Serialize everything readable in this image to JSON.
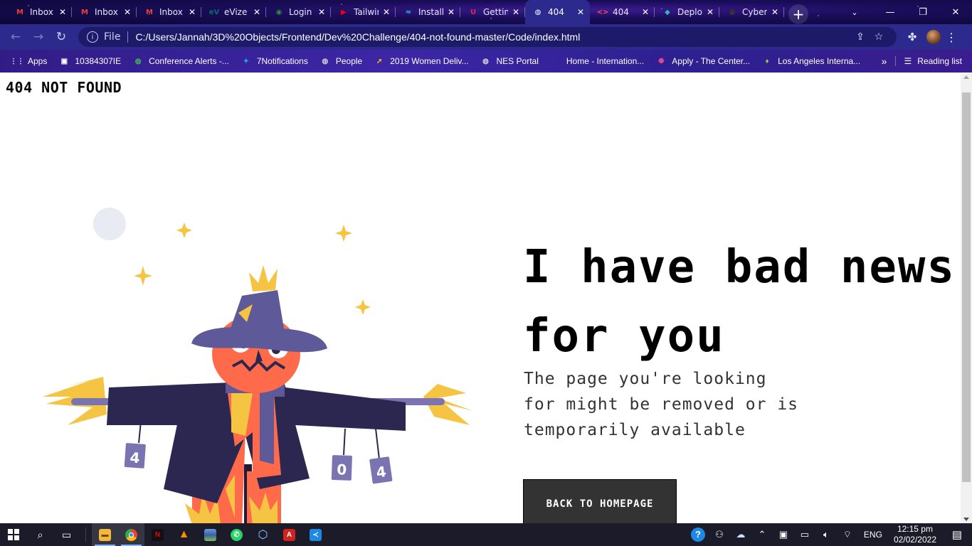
{
  "browser": {
    "tabs": [
      {
        "title": "Inbox",
        "icon": "gmail-icon",
        "fav_text": "M",
        "fav_color": "#ea4335"
      },
      {
        "title": "Inbox",
        "icon": "gmail-icon",
        "fav_text": "M",
        "fav_color": "#ea4335"
      },
      {
        "title": "Inbox",
        "icon": "gmail-icon",
        "fav_text": "M",
        "fav_color": "#ea4335"
      },
      {
        "title": "eVize",
        "icon": "evize-icon",
        "fav_text": "eV",
        "fav_color": "#0d6b6b"
      },
      {
        "title": "Login",
        "icon": "login-icon",
        "fav_text": "◉",
        "fav_color": "#2f8f3a"
      },
      {
        "title": "Tailwind",
        "icon": "youtube-icon",
        "fav_text": "▶",
        "fav_color": "#ff0000"
      },
      {
        "title": "Install",
        "icon": "tailwind-icon",
        "fav_text": "≈",
        "fav_color": "#38bdf8"
      },
      {
        "title": "Getting",
        "icon": "getting-icon",
        "fav_text": "U",
        "fav_color": "#e0245e"
      },
      {
        "title": "404",
        "icon": "globe-icon",
        "fav_text": "◍",
        "fav_color": "#ffffff",
        "active": true
      },
      {
        "title": "404",
        "icon": "code-icon",
        "fav_text": "<>",
        "fav_color": "#ff4b5c"
      },
      {
        "title": "Deploy",
        "icon": "netlify-icon",
        "fav_text": "◆",
        "fav_color": "#2bbbad"
      },
      {
        "title": "Cyber",
        "icon": "github-icon",
        "fav_text": "●",
        "fav_color": "#333333"
      }
    ],
    "new_tab": "+",
    "address": {
      "scheme": "File",
      "url": "C:/Users/Jannah/3D%20Objects/Frontend/Dev%20Challenge/404-not-found-master/Code/index.html"
    },
    "bookmarks": [
      {
        "label": "Apps",
        "icon": "apps-grid-icon",
        "fav_text": "⋮⋮",
        "color": "#e8eaed"
      },
      {
        "label": "10384307IE",
        "icon": "bookmark-id-icon",
        "fav_text": "▣",
        "color": "#ffffff"
      },
      {
        "label": "Conference Alerts -...",
        "icon": "globe-icon",
        "fav_text": "◍",
        "color": "#4caf50"
      },
      {
        "label": "7Notifications",
        "icon": "twitter-icon",
        "fav_text": "✦",
        "color": "#1da1f2"
      },
      {
        "label": "People",
        "icon": "globe-icon",
        "fav_text": "◍",
        "color": "#cfcfcf"
      },
      {
        "label": "2019 Women Deliv...",
        "icon": "arrow-icon",
        "fav_text": "➚",
        "color": "#ffc107"
      },
      {
        "label": "NES Portal",
        "icon": "globe-icon",
        "fav_text": "◍",
        "color": "#cfcfcf"
      },
      {
        "label": "Home - Internation...",
        "icon": "home-icon",
        "fav_text": "",
        "color": "#cfcfcf"
      },
      {
        "label": "Apply - The Center...",
        "icon": "center-icon",
        "fav_text": "✺",
        "color": "#e0488f"
      },
      {
        "label": "Los Angeles Interna...",
        "icon": "shield-icon",
        "fav_text": "♦",
        "color": "#9acd32"
      }
    ],
    "reading_list": "Reading list"
  },
  "page": {
    "brand": "404 NOT FOUND",
    "headline": "I have bad news for you",
    "subtext": "The page you're looking for might be removed or is temporarily available",
    "cta": "BACK TO HOMEPAGE",
    "can_labels": [
      "4",
      "0",
      "4"
    ]
  },
  "colors": {
    "headline": "#000000",
    "button_bg": "#333333",
    "hat": "#5e5a99",
    "coat": "#2b2750",
    "pumpkin": "#ff6b4a",
    "straw": "#f5c443",
    "can": "#7a75b0"
  },
  "taskbar": {
    "apps": [
      "windows-start-icon",
      "search-icon",
      "task-view-icon",
      "file-explorer-icon",
      "chrome-icon",
      "netflix-icon",
      "vlc-icon",
      "winrar-icon",
      "whatsapp-icon",
      "3d-viewer-icon",
      "acrobat-icon",
      "vscode-icon"
    ],
    "language": "ENG",
    "time": "12:15 pm",
    "date": "02/02/2022"
  }
}
